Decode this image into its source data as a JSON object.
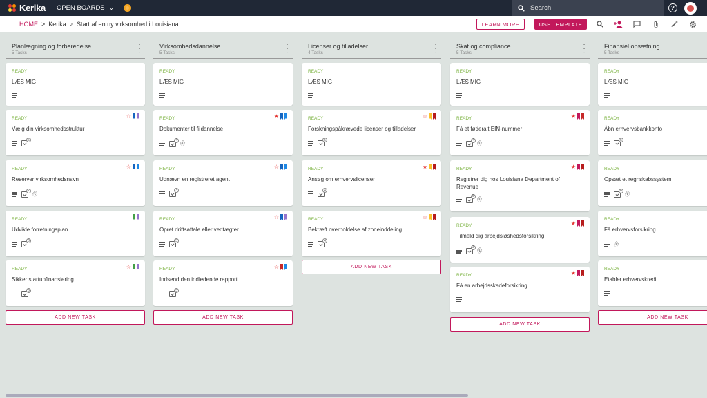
{
  "topbar": {
    "logo_text": "Kerika",
    "boards_label": "OPEN BOARDS",
    "search_placeholder": "Search",
    "help": "?"
  },
  "breadcrumb": {
    "home": "HOME",
    "sep": ">",
    "board": "Kerika",
    "page": "Start af en ny virksomhed i Louisiana"
  },
  "buttons": {
    "learn_more": "LEARN MORE",
    "use_template": "USE TEMPLATE"
  },
  "colors": {
    "accent": "#c2185b",
    "ready": "#7cb342",
    "topbar": "#202836",
    "board_bg": "#dde3e0"
  },
  "columns": [
    {
      "title": "Planlægning og forberedelse",
      "count": "5 Tasks",
      "add": "ADD NEW TASK",
      "cards": [
        {
          "status": "READY",
          "title": "LÆS MIG",
          "flags": [],
          "desc": true,
          "check": null,
          "clip": false
        },
        {
          "status": "READY",
          "title": "Vælg din virksomhedsstruktur",
          "flags": [
            "star-outline",
            "#1565c0",
            "#9575cd"
          ],
          "desc": true,
          "check": "6",
          "clip": false
        },
        {
          "status": "READY",
          "title": "Reserver virksomhedsnavn",
          "flags": [
            "star-outline",
            "#1565c0",
            "#1e88e5"
          ],
          "desc": true,
          "check": "2",
          "clip": true
        },
        {
          "status": "READY",
          "title": "Udvikle forretningsplan",
          "flags": [
            "#43a047",
            "#9575cd"
          ],
          "desc": true,
          "check": "6",
          "clip": false
        },
        {
          "status": "READY",
          "title": "Sikker startupfinansiering",
          "flags": [
            "star-outline",
            "#43a047",
            "#9575cd"
          ],
          "desc": true,
          "check": "6",
          "clip": false
        }
      ]
    },
    {
      "title": "Virksomhedsdannelse",
      "count": "5 Tasks",
      "add": "ADD NEW TASK",
      "cards": [
        {
          "status": "READY",
          "title": "LÆS MIG",
          "flags": [],
          "desc": true,
          "check": null,
          "clip": false
        },
        {
          "status": "READY",
          "title": "Dokumenter til fildannelse",
          "flags": [
            "star",
            "#1565c0",
            "#1e88e5"
          ],
          "desc": true,
          "check": "4",
          "clip": true
        },
        {
          "status": "READY",
          "title": "Udnævn en registreret agent",
          "flags": [
            "star-outline",
            "#1565c0",
            "#1e88e5"
          ],
          "desc": true,
          "check": "3",
          "clip": false
        },
        {
          "status": "READY",
          "title": "Opret driftsaftale eller vedtægter",
          "flags": [
            "star-outline",
            "#1565c0",
            "#9575cd"
          ],
          "desc": true,
          "check": "5",
          "clip": false
        },
        {
          "status": "READY",
          "title": "Indsend den indledende rapport",
          "flags": [
            "star-outline",
            "#c62828",
            "#1e88e5"
          ],
          "desc": true,
          "check": "3",
          "clip": false
        }
      ]
    },
    {
      "title": "Licenser og tilladelser",
      "count": "4 Tasks",
      "add": "ADD NEW TASK",
      "cards": [
        {
          "status": "READY",
          "title": "LÆS MIG",
          "flags": [],
          "desc": true,
          "check": null,
          "clip": false
        },
        {
          "status": "READY",
          "title": "Forskningspåkrævede licenser og tilladelser",
          "flags": [
            "star-outline",
            "#fbc02d",
            "#b71c1c"
          ],
          "desc": true,
          "check": "5",
          "clip": false
        },
        {
          "status": "READY",
          "title": "Ansøg om erhvervslicenser",
          "flags": [
            "star",
            "#fbc02d",
            "#b71c1c"
          ],
          "desc": true,
          "check": "4",
          "clip": false
        },
        {
          "status": "READY",
          "title": "Bekræft overholdelse af zoneinddeling",
          "flags": [
            "star-outline",
            "#fbc02d",
            "#b71c1c"
          ],
          "desc": true,
          "check": "4",
          "clip": false
        }
      ]
    },
    {
      "title": "Skat og compliance",
      "count": "5 Tasks",
      "add": "ADD NEW TASK",
      "cards": [
        {
          "status": "READY",
          "title": "LÆS MIG",
          "flags": [],
          "desc": true,
          "check": null,
          "clip": false
        },
        {
          "status": "READY",
          "title": "Få et føderalt EIN-nummer",
          "flags": [
            "star",
            "#c2185b",
            "#c62828"
          ],
          "desc": true,
          "check": "4",
          "clip": true
        },
        {
          "status": "READY",
          "title": "Registrer dig hos Louisiana Department of Revenue",
          "flags": [
            "star",
            "#c2185b",
            "#b71c1c"
          ],
          "desc": true,
          "check": "5",
          "clip": true
        },
        {
          "status": "READY",
          "title": "Tilmeld dig arbejdsløshedsforsikring",
          "flags": [
            "star",
            "#c2185b",
            "#b71c1c"
          ],
          "desc": true,
          "check": "3",
          "clip": true
        },
        {
          "status": "READY",
          "title": "Få en arbejdsskadeforsikring",
          "flags": [
            "star",
            "#c2185b",
            "#b71c1c"
          ],
          "desc": true,
          "check": null,
          "clip": false
        }
      ]
    },
    {
      "title": "Finansiel opsætning",
      "count": "5 Tasks",
      "add": "ADD NEW TASK",
      "cards": [
        {
          "status": "READY",
          "title": "LÆS MIG",
          "flags": [],
          "desc": true,
          "check": null,
          "clip": false
        },
        {
          "status": "READY",
          "title": "Åbn erhvervsbankkonto",
          "flags": [],
          "desc": true,
          "check": "5",
          "clip": false
        },
        {
          "status": "READY",
          "title": "Opsæt et regnskabssystem",
          "flags": [],
          "desc": true,
          "check": "6",
          "clip": true
        },
        {
          "status": "READY",
          "title": "Få erhvervsforsikring",
          "flags": [],
          "desc": true,
          "check": null,
          "clip": true
        },
        {
          "status": "READY",
          "title": "Etabler erhvervskredit",
          "flags": [],
          "desc": true,
          "check": null,
          "clip": false
        }
      ]
    }
  ]
}
